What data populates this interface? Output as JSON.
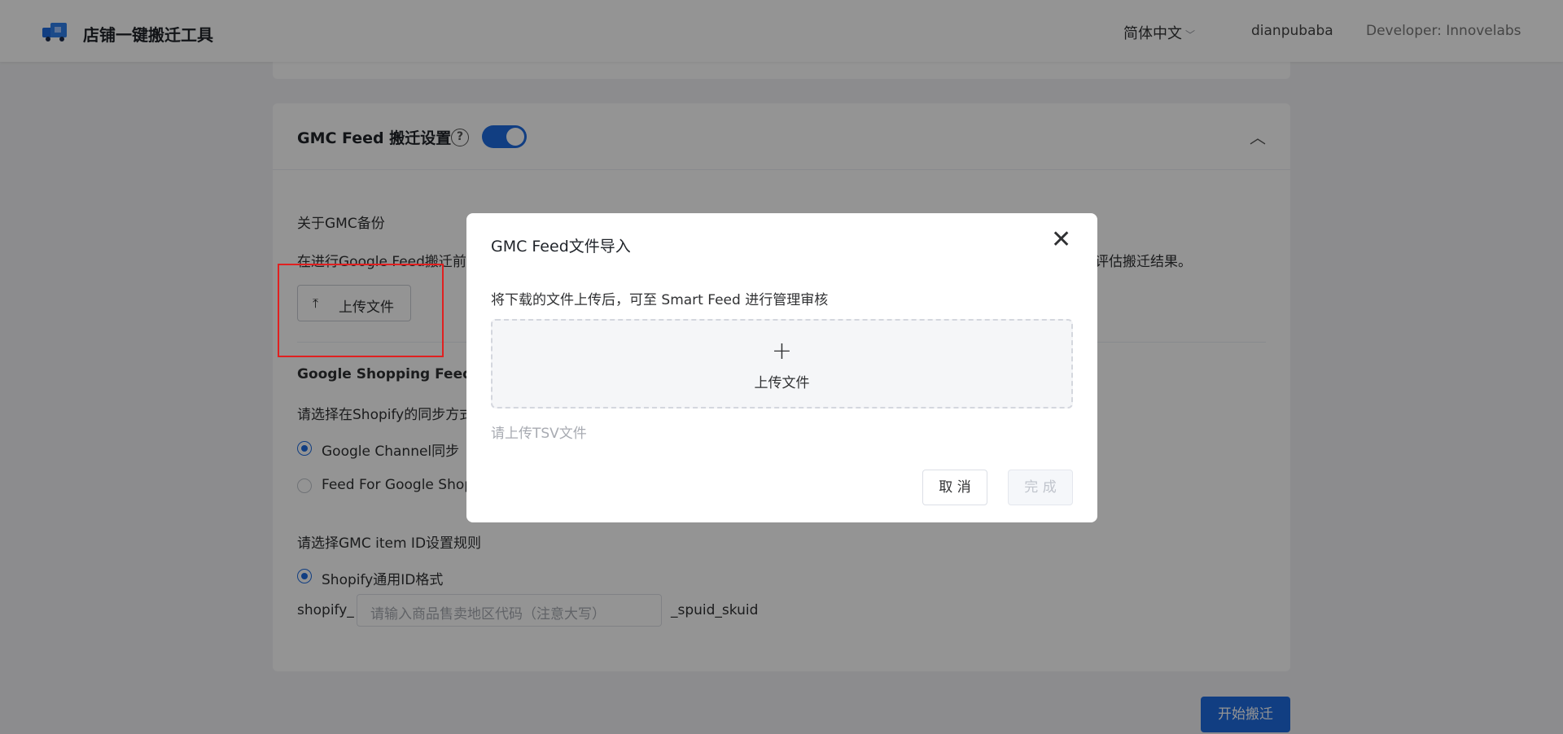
{
  "header": {
    "brand": "店铺一键搬迁工具",
    "language": "简体中文",
    "username": "dianpubaba",
    "developer": "Developer: Innovelabs"
  },
  "section": {
    "title": "GMC Feed 搬迁设置",
    "toggle_on": true,
    "backup_heading": "关于GMC备份",
    "backup_desc_left": "在进行Google Feed搬迁前，",
    "backup_desc_right": "评估搬迁结果。",
    "upload_button": "上传文件",
    "feed_heading": "Google Shopping Feed Pro",
    "sync_question": "请选择在Shopify的同步方式",
    "sync_options": [
      {
        "label": "Google Channel同步",
        "selected": true
      },
      {
        "label": "Feed For Google Shopp",
        "selected": false
      }
    ],
    "id_rule_question": "请选择GMC item ID设置规则",
    "id_format_option": "Shopify通用ID格式",
    "id_prefix": "shopify_",
    "id_input_placeholder": "请输入商品售卖地区代码（注意大写）",
    "id_suffix": "_spuid_skuid"
  },
  "start_button": "开始搬迁",
  "modal": {
    "title": "GMC Feed文件导入",
    "description": "将下载的文件上传后，可至 Smart Feed 进行管理审核",
    "dropzone_label": "上传文件",
    "hint": "请上传TSV文件",
    "cancel": "取 消",
    "done": "完 成"
  },
  "colors": {
    "primary": "#1e6ce0",
    "annotation": "#e02020"
  }
}
